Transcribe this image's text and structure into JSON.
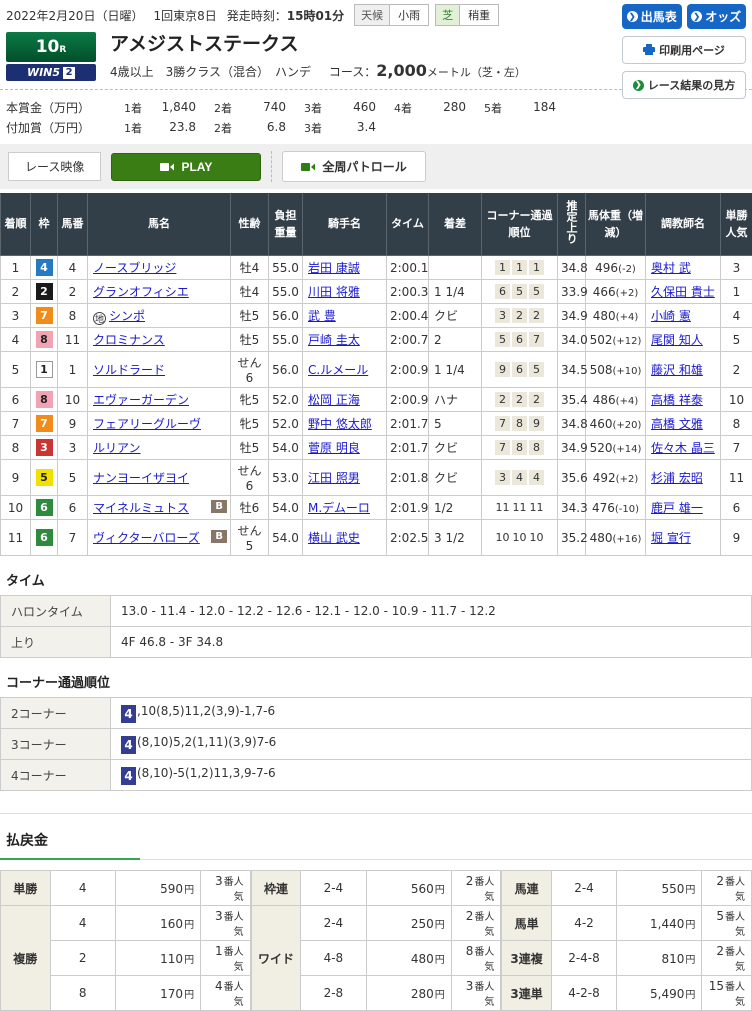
{
  "topbar": {
    "date": "2022年2月20日（日曜）",
    "meeting": "1回東京8日",
    "start_label": "発走時刻：",
    "start_time": "15時01分",
    "weather": {
      "label": "天候",
      "value": "小雨"
    },
    "going": {
      "label": "芝",
      "value": "稍重"
    },
    "entries_button": "出馬表",
    "odds_button": "オッズ"
  },
  "race_header": {
    "race_number": "10",
    "race_number_unit": "R",
    "win5_label": "WIN5",
    "win5_number": "2",
    "title": "アメジストステークス",
    "conditions": "4歳以上　3勝クラス（混合）　ハンデ",
    "course_label": "コース：",
    "course_distance": "2,000",
    "course_unit": "メートル（芝・左）",
    "print_button": "印刷用ページ",
    "help_button": "レース結果の見方"
  },
  "prize": {
    "main_label": "本賞金（万円）",
    "main": [
      {
        "place": "1着",
        "amount": "1,840"
      },
      {
        "place": "2着",
        "amount": "740"
      },
      {
        "place": "3着",
        "amount": "460"
      },
      {
        "place": "4着",
        "amount": "280"
      },
      {
        "place": "5着",
        "amount": "184"
      }
    ],
    "bonus_label": "付加賞（万円）",
    "bonus": [
      {
        "place": "1着",
        "amount": "23.8"
      },
      {
        "place": "2着",
        "amount": "6.8"
      },
      {
        "place": "3着",
        "amount": "3.4"
      }
    ]
  },
  "video_bar": {
    "label": "レース映像",
    "play_button": "PLAY",
    "patrol_button": "全周パトロール"
  },
  "results_table": {
    "headers": [
      "着順",
      "枠",
      "馬番",
      "馬名",
      "性齢",
      "負担重量",
      "騎手名",
      "タイム",
      "着差",
      "コーナー通過順位",
      "推定上り",
      "馬体重（増減）",
      "調教師名",
      "単勝人気"
    ],
    "rows": [
      {
        "place": "1",
        "frame": "4",
        "horse_no": "4",
        "horse": "ノースブリッジ",
        "mark": "",
        "blinkers": false,
        "sex_age": "牡4",
        "weight": "55.0",
        "jockey": "岩田 康誠",
        "time": "2:00.1",
        "margin": "",
        "corners": [
          "1",
          "1",
          "1"
        ],
        "last3f": "34.8",
        "horse_weight": "496",
        "weight_diff": "(-2)",
        "trainer": "奥村 武",
        "popularity": "3"
      },
      {
        "place": "2",
        "frame": "2",
        "horse_no": "2",
        "horse": "グランオフィシエ",
        "mark": "",
        "blinkers": false,
        "sex_age": "牡4",
        "weight": "55.0",
        "jockey": "川田 将雅",
        "time": "2:00.3",
        "margin": "1 1/4",
        "corners": [
          "6",
          "5",
          "5"
        ],
        "last3f": "33.9",
        "horse_weight": "466",
        "weight_diff": "(+2)",
        "trainer": "久保田 貴士",
        "popularity": "1"
      },
      {
        "place": "3",
        "frame": "7",
        "horse_no": "8",
        "horse": "シンポ",
        "mark": "地",
        "blinkers": false,
        "sex_age": "牡5",
        "weight": "56.0",
        "jockey": "武 豊",
        "time": "2:00.4",
        "margin": "クビ",
        "corners": [
          "3",
          "2",
          "2"
        ],
        "last3f": "34.9",
        "horse_weight": "480",
        "weight_diff": "(+4)",
        "trainer": "小崎 憲",
        "popularity": "4"
      },
      {
        "place": "4",
        "frame": "8",
        "horse_no": "11",
        "horse": "クロミナンス",
        "mark": "",
        "blinkers": false,
        "sex_age": "牡5",
        "weight": "55.0",
        "jockey": "戸崎 圭太",
        "time": "2:00.7",
        "margin": "2",
        "corners": [
          "5",
          "6",
          "7"
        ],
        "last3f": "34.0",
        "horse_weight": "502",
        "weight_diff": "(+12)",
        "trainer": "尾関 知人",
        "popularity": "5"
      },
      {
        "place": "5",
        "frame": "1",
        "horse_no": "1",
        "horse": "ソルドラード",
        "mark": "",
        "blinkers": false,
        "sex_age": "せん6",
        "weight": "56.0",
        "jockey": "C.ルメール",
        "time": "2:00.9",
        "margin": "1 1/4",
        "corners": [
          "9",
          "6",
          "5"
        ],
        "last3f": "34.5",
        "horse_weight": "508",
        "weight_diff": "(+10)",
        "trainer": "藤沢 和雄",
        "popularity": "2"
      },
      {
        "place": "6",
        "frame": "8",
        "horse_no": "10",
        "horse": "エヴァーガーデン",
        "mark": "",
        "blinkers": false,
        "sex_age": "牝5",
        "weight": "52.0",
        "jockey": "松岡 正海",
        "time": "2:00.9",
        "margin": "ハナ",
        "corners": [
          "2",
          "2",
          "2"
        ],
        "last3f": "35.4",
        "horse_weight": "486",
        "weight_diff": "(+4)",
        "trainer": "高橋 祥泰",
        "popularity": "10"
      },
      {
        "place": "7",
        "frame": "7",
        "horse_no": "9",
        "horse": "フェアリーグルーヴ",
        "mark": "",
        "blinkers": false,
        "sex_age": "牝5",
        "weight": "52.0",
        "jockey": "野中 悠太郎",
        "time": "2:01.7",
        "margin": "5",
        "corners": [
          "7",
          "8",
          "9"
        ],
        "last3f": "34.8",
        "horse_weight": "460",
        "weight_diff": "(+20)",
        "trainer": "高橋 文雅",
        "popularity": "8"
      },
      {
        "place": "8",
        "frame": "3",
        "horse_no": "3",
        "horse": "ルリアン",
        "mark": "",
        "blinkers": false,
        "sex_age": "牡5",
        "weight": "54.0",
        "jockey": "菅原 明良",
        "time": "2:01.7",
        "margin": "クビ",
        "corners": [
          "7",
          "8",
          "8"
        ],
        "last3f": "34.9",
        "horse_weight": "520",
        "weight_diff": "(+14)",
        "trainer": "佐々木 晶三",
        "popularity": "7"
      },
      {
        "place": "9",
        "frame": "5",
        "horse_no": "5",
        "horse": "ナンヨーイザヨイ",
        "mark": "",
        "blinkers": false,
        "sex_age": "せん6",
        "weight": "53.0",
        "jockey": "江田 照男",
        "time": "2:01.8",
        "margin": "クビ",
        "corners": [
          "3",
          "4",
          "4"
        ],
        "last3f": "35.6",
        "horse_weight": "492",
        "weight_diff": "(+2)",
        "trainer": "杉浦 宏昭",
        "popularity": "11"
      },
      {
        "place": "10",
        "frame": "6",
        "horse_no": "6",
        "horse": "マイネルミュトス",
        "mark": "",
        "blinkers": true,
        "sex_age": "牡6",
        "weight": "54.0",
        "jockey": "M.デムーロ",
        "time": "2:01.9",
        "margin": "1/2",
        "corners": [
          "11",
          "11",
          "11"
        ],
        "last3f": "34.3",
        "horse_weight": "476",
        "weight_diff": "(-10)",
        "trainer": "鹿戸 雄一",
        "popularity": "6"
      },
      {
        "place": "11",
        "frame": "6",
        "horse_no": "7",
        "horse": "ヴィクターバローズ",
        "mark": "",
        "blinkers": true,
        "sex_age": "せん5",
        "weight": "54.0",
        "jockey": "横山 武史",
        "time": "2:02.5",
        "margin": "3 1/2",
        "corners": [
          "10",
          "10",
          "10"
        ],
        "last3f": "35.2",
        "horse_weight": "480",
        "weight_diff": "(+16)",
        "trainer": "堀 宣行",
        "popularity": "9"
      }
    ],
    "blinkers_badge": "B"
  },
  "time_section": {
    "heading": "タイム",
    "rows": [
      {
        "label": "ハロンタイム",
        "value": "13.0 - 11.4 - 12.0 - 12.2 - 12.6 - 12.1 - 12.0 - 10.9 - 11.7 - 12.2"
      },
      {
        "label": "上り",
        "value": "4F 46.8 - 3F 34.8"
      }
    ]
  },
  "corner_section": {
    "heading": "コーナー通過順位",
    "rows": [
      {
        "label": "2コーナー",
        "leader": "4",
        "order": ",10(8,5)11,2(3,9)-1,7-6"
      },
      {
        "label": "3コーナー",
        "leader": "4",
        "order": "(8,10)5,2(1,11)(3,9)7-6"
      },
      {
        "label": "4コーナー",
        "leader": "4",
        "order": "(8,10)-5(1,2)11,3,9-7-6"
      }
    ]
  },
  "payout_section": {
    "heading": "払戻金",
    "unit_amount": "円",
    "unit_popularity": "番人気",
    "columns": [
      {
        "groups": [
          {
            "label": "単勝",
            "rows": [
              {
                "combo": "4",
                "amount": "590",
                "popularity": "3"
              }
            ]
          },
          {
            "label": "複勝",
            "rows": [
              {
                "combo": "4",
                "amount": "160",
                "popularity": "3"
              },
              {
                "combo": "2",
                "amount": "110",
                "popularity": "1"
              },
              {
                "combo": "8",
                "amount": "170",
                "popularity": "4"
              }
            ]
          }
        ]
      },
      {
        "groups": [
          {
            "label": "枠連",
            "rows": [
              {
                "combo": "2-4",
                "amount": "560",
                "popularity": "2"
              }
            ]
          },
          {
            "label": "ワイド",
            "rows": [
              {
                "combo": "2-4",
                "amount": "250",
                "popularity": "2"
              },
              {
                "combo": "4-8",
                "amount": "480",
                "popularity": "8"
              },
              {
                "combo": "2-8",
                "amount": "280",
                "popularity": "3"
              }
            ]
          }
        ]
      },
      {
        "groups": [
          {
            "label": "馬連",
            "rows": [
              {
                "combo": "2-4",
                "amount": "550",
                "popularity": "2"
              }
            ]
          },
          {
            "label": "馬単",
            "rows": [
              {
                "combo": "4-2",
                "amount": "1,440",
                "popularity": "5"
              }
            ]
          },
          {
            "label": "3連複",
            "rows": [
              {
                "combo": "2-4-8",
                "amount": "810",
                "popularity": "2"
              }
            ]
          },
          {
            "label": "3連単",
            "rows": [
              {
                "combo": "4-2-8",
                "amount": "5,490",
                "popularity": "15"
              }
            ]
          }
        ]
      }
    ]
  },
  "colors": {
    "accent_blue": "#1667c5",
    "table_header": "#333f48",
    "play_green": "#3a7d15",
    "payout_green": "#2fa84f",
    "leader_navy": "#333d93"
  }
}
